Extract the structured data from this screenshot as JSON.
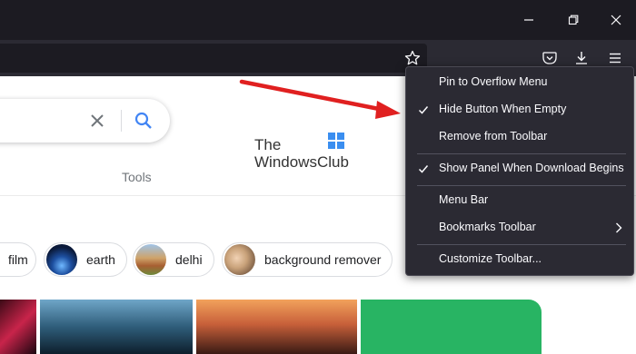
{
  "colors": {
    "titlebar": "#1c1b22",
    "toolbar": "#2b2a33",
    "menu_bg": "#2b2a33",
    "menu_text": "#fbfbfe",
    "accent_blue": "#4285f4",
    "arrow_red": "#e02020"
  },
  "window_controls": [
    "minimize-icon",
    "maximize-icon",
    "close-icon"
  ],
  "toolbar": {
    "icons": [
      "star-icon",
      "pocket-icon",
      "download-icon",
      "hamburger-menu-icon"
    ]
  },
  "page": {
    "tools_label": "Tools",
    "logo": {
      "line1": "The",
      "line2": "WindowsClub"
    },
    "chips": [
      {
        "label": "film"
      },
      {
        "label": "earth"
      },
      {
        "label": "delhi"
      },
      {
        "label": "background remover"
      }
    ]
  },
  "context_menu": {
    "items": [
      {
        "label": "Pin to Overflow Menu",
        "checked": false
      },
      {
        "label": "Hide Button When Empty",
        "checked": true
      },
      {
        "label": "Remove from Toolbar",
        "checked": false
      },
      {
        "label": "Show Panel When Download Begins",
        "checked": true
      },
      {
        "label": "Menu Bar",
        "checked": false
      },
      {
        "label": "Bookmarks Toolbar",
        "checked": false,
        "submenu": true
      },
      {
        "label": "Customize Toolbar...",
        "checked": false
      }
    ]
  }
}
